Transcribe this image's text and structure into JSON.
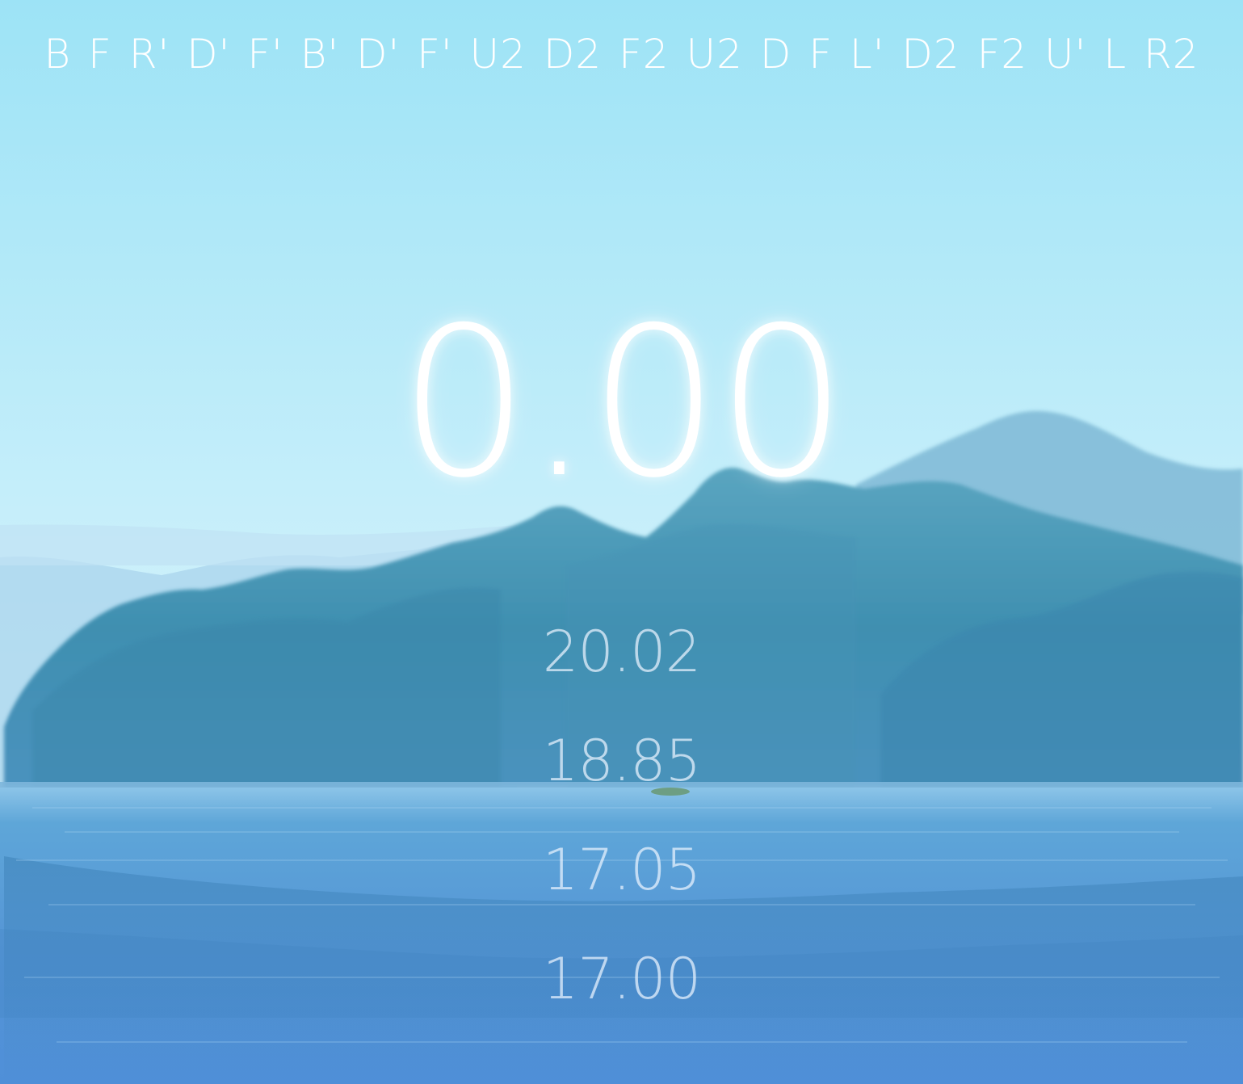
{
  "scramble": "B F R' D' F' B' D' F' U2 D2 F2 U2 D F L' D2 F2 U' L R2",
  "timer": {
    "display": "0.00"
  },
  "history": [
    {
      "time": "20.02"
    },
    {
      "time": "18.85"
    },
    {
      "time": "17.05"
    },
    {
      "time": "17.00"
    }
  ],
  "theme": {
    "sky_top": "#9fe4f6",
    "sky_mid": "#c8f0fb",
    "haze": "#d6f2fc",
    "hills_far": "#9ed0ea",
    "forest_dark": "#3f8fb0",
    "forest_light": "#5fa9c3",
    "water_top": "#5fa6d6",
    "water_bottom": "#4b8fd6",
    "text": "#ffffff"
  }
}
